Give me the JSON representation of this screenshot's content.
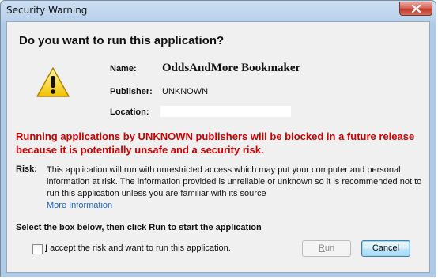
{
  "window": {
    "title": "Security Warning",
    "close_icon": "close-x-icon"
  },
  "dialog": {
    "heading": "Do you want to run this application?",
    "warning_icon": "warning-triangle-icon",
    "name_label": "Name:",
    "name_value": "OddsAndMore Bookmaker",
    "publisher_label": "Publisher:",
    "publisher_value": "UNKNOWN",
    "location_label": "Location:",
    "location_value": "",
    "red_warning_line1": "Running applications by UNKNOWN publishers will be blocked in a future release",
    "red_warning_line2": "because it is potentially unsafe and a security risk.",
    "risk_label": "Risk:",
    "risk_line1": "This application will run with unrestricted access which may put your computer and personal",
    "risk_line2": "information at risk. The information provided is unreliable or unknown so it is recommended not to",
    "risk_line3": "run this application unless you are familiar with its source",
    "more_info": "More Information",
    "select_instruction": "Select the box below, then click Run to start the application",
    "accept_checkbox_label_first": "I",
    "accept_checkbox_label_rest": " accept the risk and want to run this application.",
    "accept_checked": false
  },
  "buttons": {
    "run_first": "R",
    "run_rest": "un",
    "run_enabled": false,
    "cancel": "Cancel"
  },
  "colors": {
    "warning_red": "#cc0000",
    "link_blue": "#1f5fbf",
    "client_bg": "#f0f0f0"
  }
}
